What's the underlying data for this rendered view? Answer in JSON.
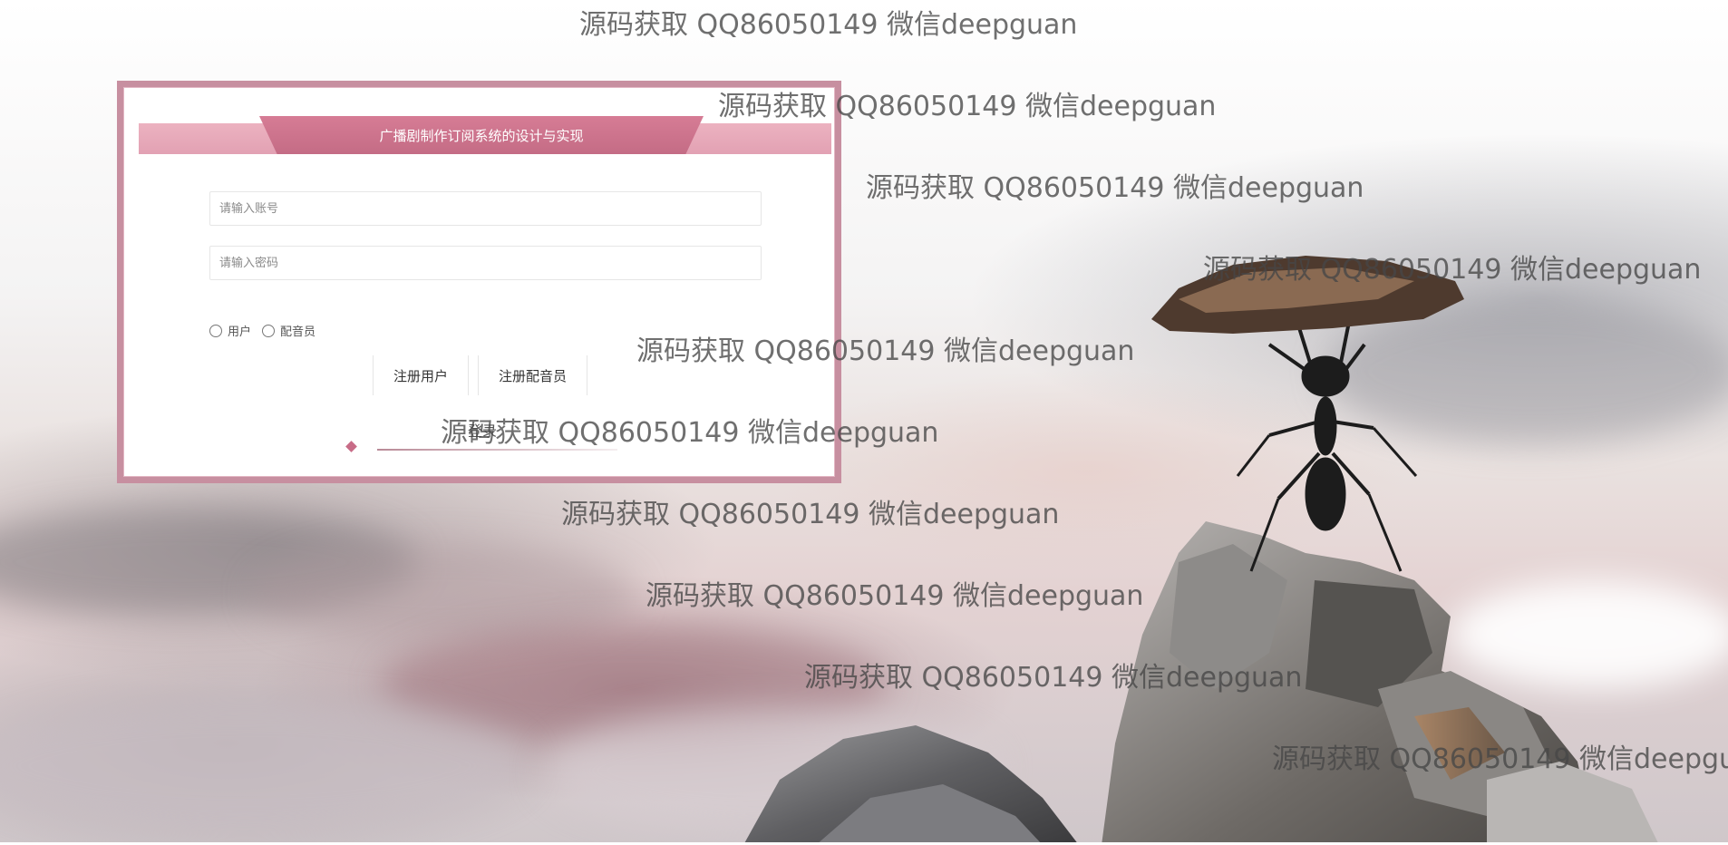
{
  "login": {
    "title": "广播剧制作订阅系统的设计与实现",
    "account_placeholder": "请输入账号",
    "password_placeholder": "请输入密码",
    "roles": [
      {
        "label": "用户"
      },
      {
        "label": "配音员"
      }
    ],
    "register_user_label": "注册用户",
    "register_dubber_label": "注册配音员",
    "login_button_label": "登录"
  },
  "watermark": {
    "text": "源码获取 QQ86050149 微信deepguan"
  },
  "colors": {
    "accent": "#c46c85",
    "banner_light": "#e2a1b3",
    "card_border": "#c78fa0"
  }
}
